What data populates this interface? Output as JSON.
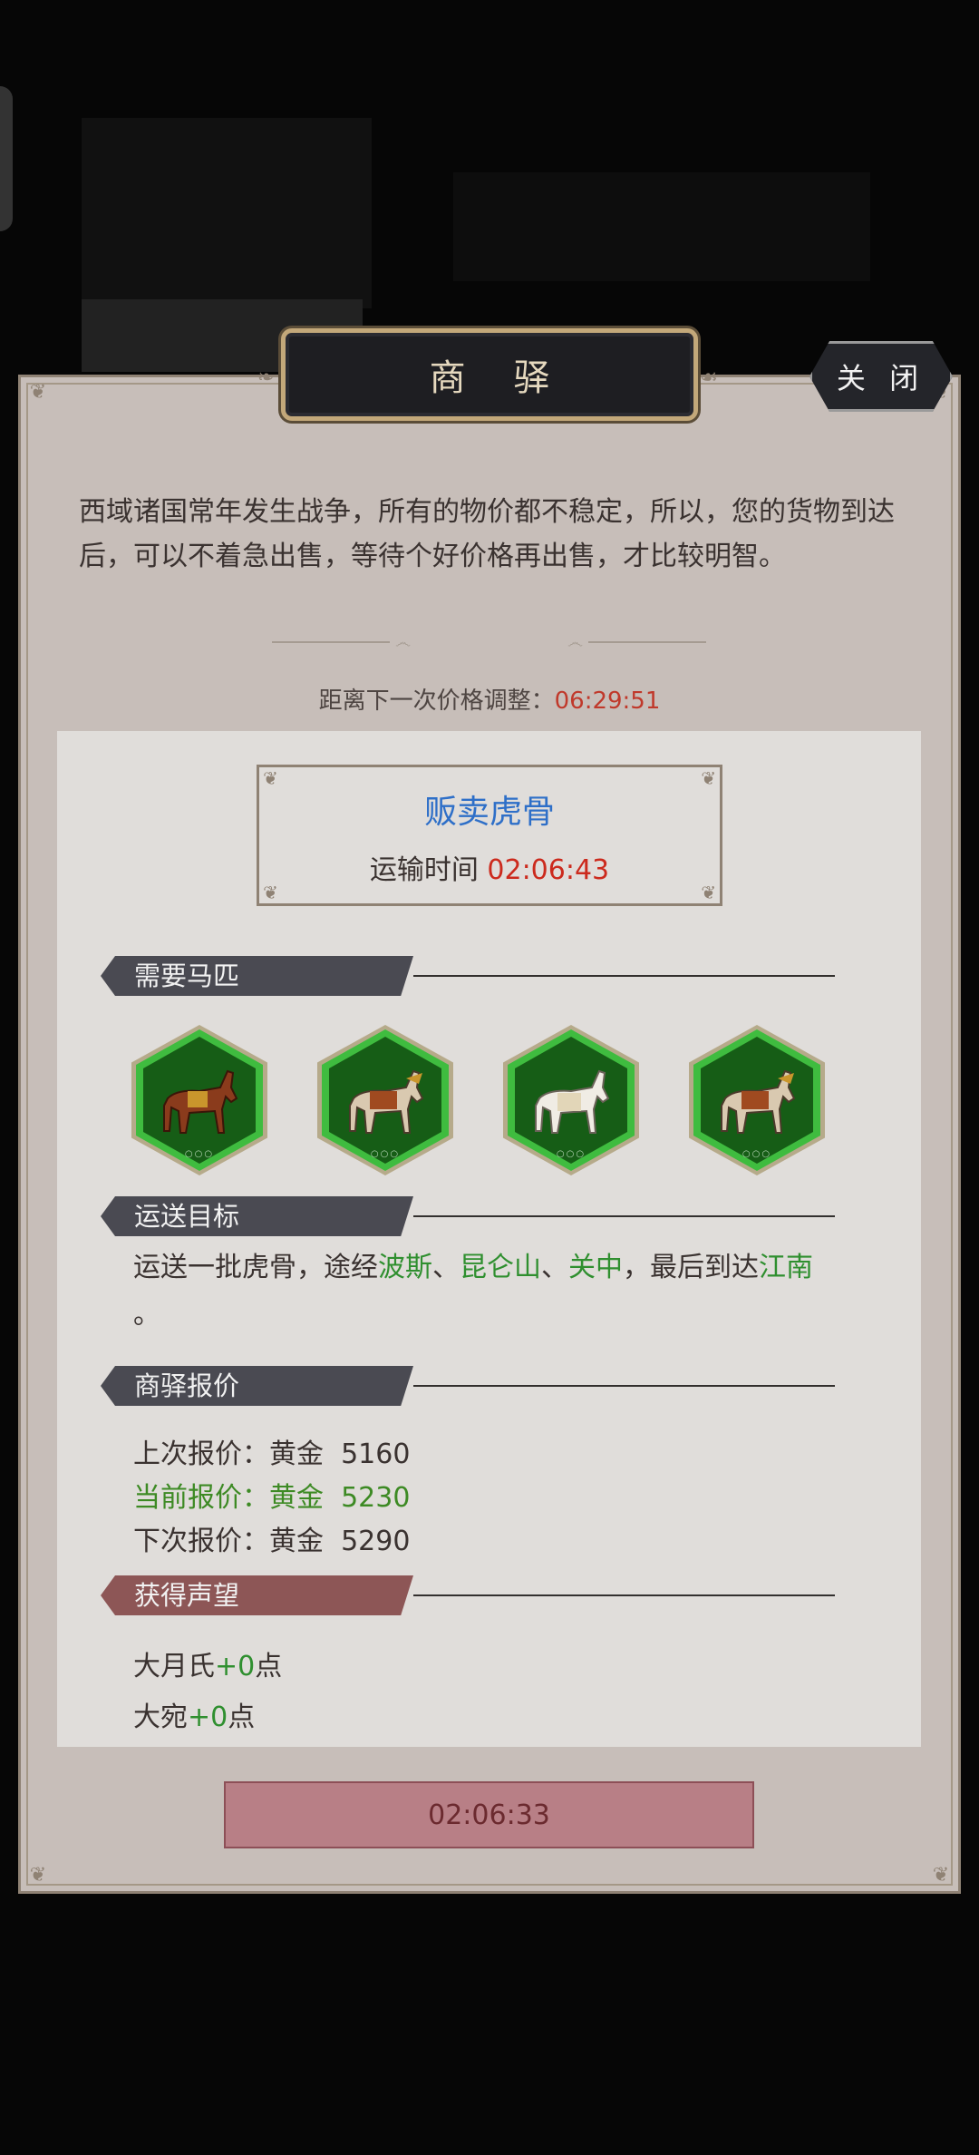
{
  "title": "商 驿",
  "close_label": "关 闭",
  "description": "西域诸国常年发生战争，所有的物价都不稳定，所以，您的货物到达后，可以不着急出售，等待个好价格再出售，才比较明智。",
  "next_adjust": {
    "label": "距离下一次价格调整：",
    "value": "06:29:51"
  },
  "sell": {
    "title": "贩卖虎骨",
    "transport_label": "运输时间",
    "transport_value": "02:06:43"
  },
  "sections": {
    "horses": "需要马匹",
    "target": "运送目标",
    "quote": "商驿报价",
    "reputation": "获得声望"
  },
  "horses": [
    {
      "name": "brown-horse-icon",
      "color": "#8a3b1c"
    },
    {
      "name": "armored-horse-icon",
      "color": "#d9c9b0"
    },
    {
      "name": "white-horse-icon",
      "color": "#f0ece4"
    },
    {
      "name": "armored-horse-icon",
      "color": "#d9c9b0"
    }
  ],
  "route": {
    "prefix": "运送一批虎骨，途经",
    "stop1": "波斯",
    "sep1": "、",
    "stop2": "昆仑山",
    "sep2": "、",
    "stop3": "关中",
    "mid": "，最后到达",
    "dest": "江南",
    "end": "。"
  },
  "quotes": {
    "last": "上次报价：黄金  5160",
    "current": "当前报价：黄金  5230",
    "next": "下次报价：黄金  5290"
  },
  "reputation": [
    {
      "name": "大月氏",
      "value": "+0",
      "unit": "点"
    },
    {
      "name": "大宛",
      "value": "+0",
      "unit": "点"
    }
  ],
  "action_timer": "02:06:33"
}
